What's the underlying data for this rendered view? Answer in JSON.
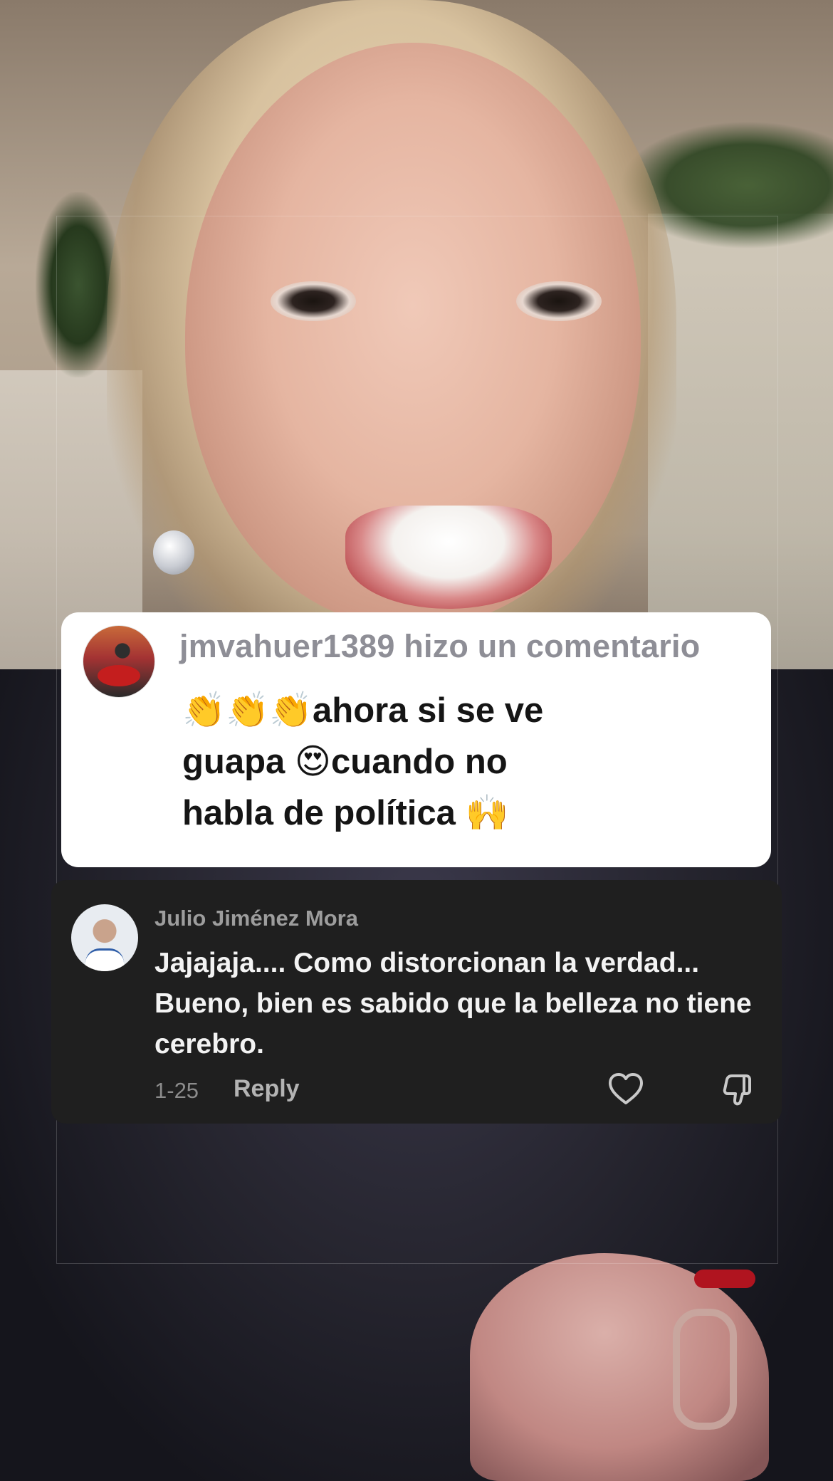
{
  "sticker": {
    "username": "jmvahuer1389",
    "action": "hizo un comentario",
    "line1_emoji": "👏👏👏",
    "line1_text": "ahora si se ve",
    "line2_a": "guapa ",
    "line2_emoji": "😍",
    "line2_b": "cuando no",
    "line3_text": "habla de política ",
    "line3_emoji": "🙌"
  },
  "reply": {
    "name": "Julio Jiménez Mora",
    "body": "Jajajaja.... Como distorcionan la verdad... Bueno, bien es sabido que la belleza no tiene cerebro.",
    "date": "1-25",
    "reply_label": "Reply",
    "like_icon": "heart-icon",
    "dislike_icon": "thumbs-down-icon"
  },
  "colors": {
    "sticker_bg": "#ffffff",
    "card_bg": "#1f1f1f",
    "accent_nail": "#b0141f"
  }
}
